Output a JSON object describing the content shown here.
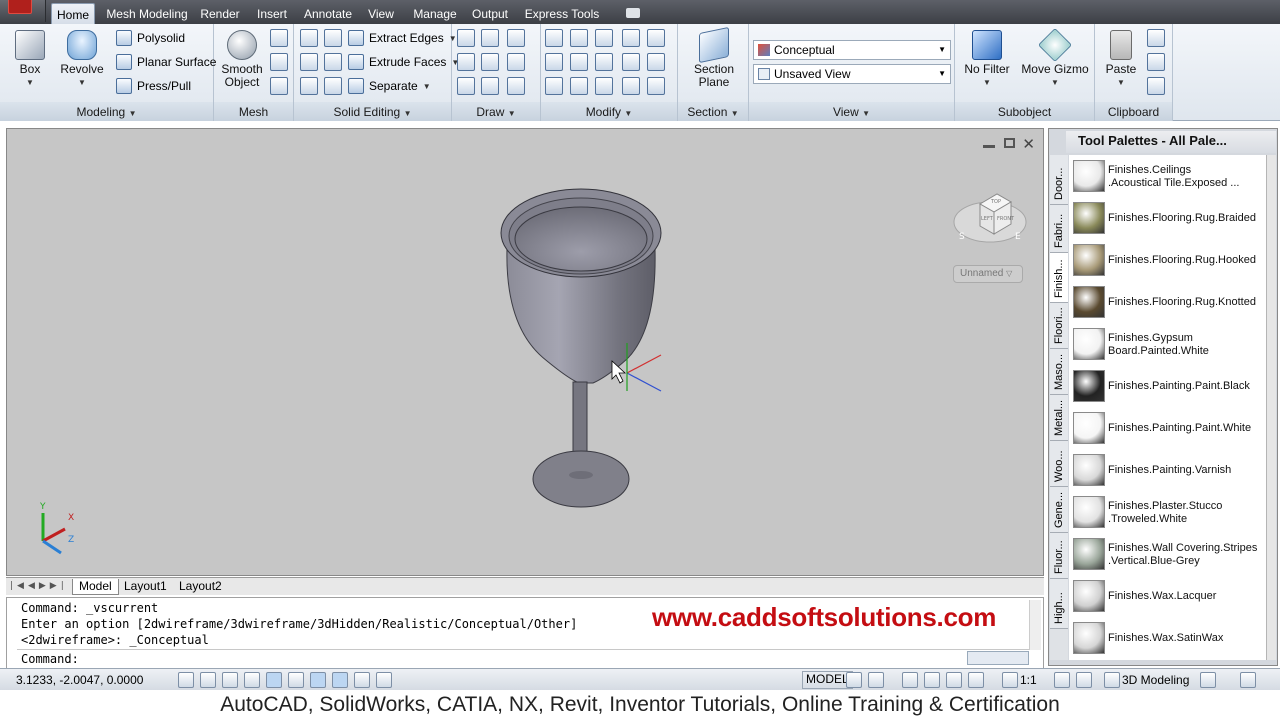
{
  "menubar": {
    "tabs": [
      "Home",
      "Mesh Modeling",
      "Render",
      "Insert",
      "Annotate",
      "View",
      "Manage",
      "Output",
      "Express Tools"
    ]
  },
  "ribbon": {
    "modeling": {
      "title": "Modeling",
      "box": "Box",
      "revolve": "Revolve",
      "polysolid": "Polysolid",
      "planar_surface": "Planar Surface",
      "press_pull": "Press/Pull"
    },
    "mesh": {
      "title": "Mesh",
      "smooth_object_1": "Smooth",
      "smooth_object_2": "Object"
    },
    "solid_editing": {
      "title": "Solid Editing",
      "extract_edges": "Extract Edges",
      "extrude_faces": "Extrude Faces",
      "separate": "Separate"
    },
    "draw": {
      "title": "Draw"
    },
    "modify": {
      "title": "Modify"
    },
    "section": {
      "title": "Section",
      "plane_1": "Section",
      "plane_2": "Plane"
    },
    "view": {
      "title": "View",
      "visual_style": "Conceptual",
      "named_view": "Unsaved View"
    },
    "subobject": {
      "title": "Subobject",
      "no_filter": "No Filter",
      "move_gizmo": "Move Gizmo"
    },
    "clipboard": {
      "title": "Clipboard",
      "paste": "Paste"
    }
  },
  "viewport": {
    "viewcube_labels": [
      "TOP",
      "LEFT",
      "FRONT"
    ],
    "compass": [
      "S",
      "E"
    ],
    "ucs_name": "Unnamed",
    "ucs_axes": [
      "Y",
      "X",
      "Z"
    ]
  },
  "layout_tabs": [
    "Model",
    "Layout1",
    "Layout2"
  ],
  "command": {
    "lines": [
      "Command: _vscurrent",
      "Enter an option [2dwireframe/3dwireframe/3dHidden/Realistic/Conceptual/Other]",
      "<2dwireframe>: _Conceptual"
    ],
    "prompt": "Command:"
  },
  "watermark": "www.caddsoftsolutions.com",
  "status": {
    "coords": "3.1233, -2.0047, 0.0000",
    "model": "MODEL",
    "scale": "1:1",
    "workspace": "3D Modeling"
  },
  "footer": "AutoCAD, SolidWorks, CATIA, NX, Revit, Inventor Tutorials, Online Training & Certification",
  "palette": {
    "title": "Tool Palettes - All Pale...",
    "tabs": [
      "Door...",
      "Fabri...",
      "Finish...",
      "Floori...",
      "Maso...",
      "Metal...",
      "Woo...",
      "Gene...",
      "Fluor...",
      "High..."
    ],
    "items": [
      {
        "line1": "Finishes.Ceilings",
        "line2": ".Acoustical Tile.Exposed ...",
        "color": "#e9e9e9"
      },
      {
        "line1": "Finishes.Flooring.Rug.Braided",
        "line2": "",
        "color": "#8a8a5a"
      },
      {
        "line1": "Finishes.Flooring.Rug.Hooked",
        "line2": "",
        "color": "#a89a78"
      },
      {
        "line1": "Finishes.Flooring.Rug.Knotted",
        "line2": "",
        "color": "#5a4a30"
      },
      {
        "line1": "Finishes.Gypsum",
        "line2": "Board.Painted.White",
        "color": "#f2f2f2"
      },
      {
        "line1": "Finishes.Painting.Paint.Black",
        "line2": "",
        "color": "#222222"
      },
      {
        "line1": "Finishes.Painting.Paint.White",
        "line2": "",
        "color": "#f5f5f5"
      },
      {
        "line1": "Finishes.Painting.Varnish",
        "line2": "",
        "color": "#d8d8d8"
      },
      {
        "line1": "Finishes.Plaster.Stucco",
        "line2": ".Troweled.White",
        "color": "#e2e2e2"
      },
      {
        "line1": "Finishes.Wall Covering.Stripes",
        "line2": ".Vertical.Blue-Grey",
        "color": "#9aa69a"
      },
      {
        "line1": "Finishes.Wax.Lacquer",
        "line2": "",
        "color": "#d0d0d0"
      },
      {
        "line1": "Finishes.Wax.SatinWax",
        "line2": "",
        "color": "#d6d6d6"
      }
    ]
  }
}
